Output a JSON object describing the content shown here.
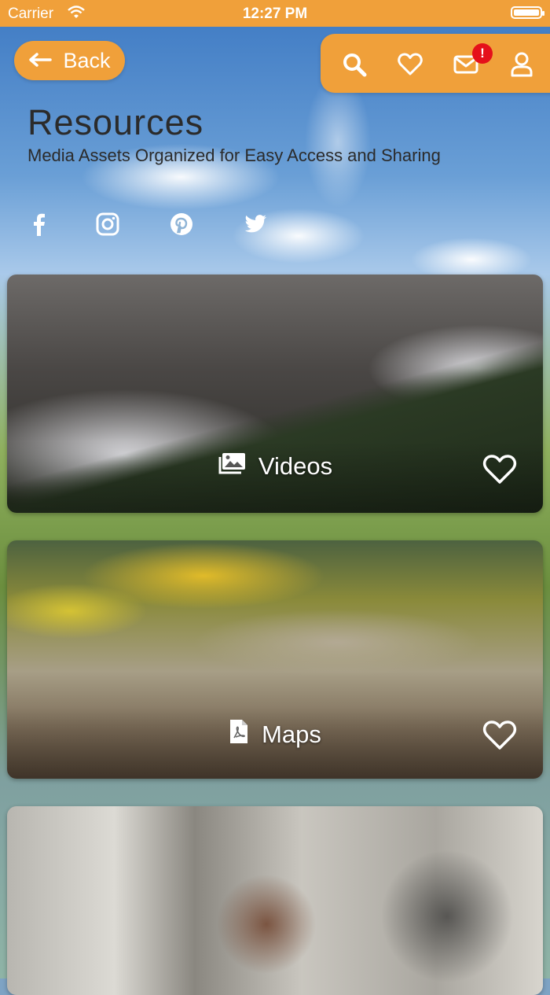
{
  "status_bar": {
    "carrier": "Carrier",
    "time": "12:27 PM"
  },
  "header": {
    "back_label": "Back",
    "notification_count": "!",
    "icons": [
      "search-icon",
      "heart-icon",
      "mail-icon",
      "user-icon"
    ]
  },
  "page": {
    "title": "Resources",
    "subtitle": "Media Assets Organized for Easy Access and Sharing"
  },
  "social": [
    "facebook-icon",
    "instagram-icon",
    "pinterest-icon",
    "twitter-icon"
  ],
  "cards": [
    {
      "label": "Videos",
      "icon": "images-icon"
    },
    {
      "label": "Maps",
      "icon": "pdf-file-icon"
    },
    {
      "label": "",
      "icon": ""
    }
  ],
  "colors": {
    "accent": "#f0a03a",
    "badge": "#e5101a",
    "text": "#2b2b2b"
  }
}
